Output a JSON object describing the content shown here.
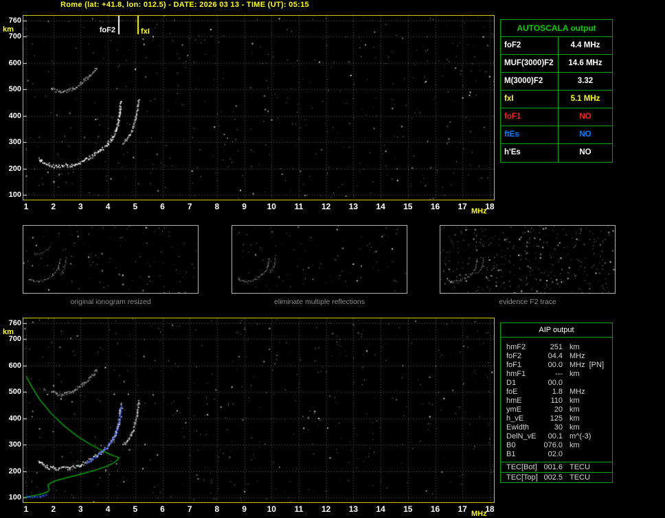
{
  "header": {
    "title": "Rome (lat: +41.8, lon: 012.5) - DATE: 2026 03 13 - TIME (UT): 05:15"
  },
  "colors": {
    "plot_border": "#cfc400",
    "table_border": "#00a400",
    "autoscala_title_green": "#00d000",
    "header_yellow": "#ffff00",
    "axis_label_white": "#ffffff",
    "unit_yellow": "#ffff00",
    "caption_gray": "#8f8f8f",
    "profile_green": "#00c000",
    "restored_blue": "#3355ff",
    "fof1_red": "#ff2020",
    "ftes_blue": "#0080ff"
  },
  "autoscala_table": {
    "title": "AUTOSCALA output",
    "rows": [
      {
        "label": "foF2",
        "value": "4.4 MHz",
        "color": "#ffffff"
      },
      {
        "label": "MUF(3000)F2",
        "value": "14.6 MHz",
        "color": "#ffffff"
      },
      {
        "label": "M(3000)F2",
        "value": "3.32",
        "color": "#ffffff"
      },
      {
        "label": "fxI",
        "value": "5.1 MHz",
        "color": "#ffff00"
      },
      {
        "label": "foF1",
        "value": "NO",
        "color": "#ff2020"
      },
      {
        "label": "ftEs",
        "value": "NO",
        "color": "#0080ff"
      },
      {
        "label": "h'Es",
        "value": "NO",
        "color": "#ffffff"
      }
    ]
  },
  "thumbnails": [
    {
      "caption": "original ionogram resized"
    },
    {
      "caption": "eliminate multiple reflections"
    },
    {
      "caption": "evidence F2 trace"
    }
  ],
  "aip_table": {
    "title": "AIP output",
    "rows": [
      {
        "name": "hmF2",
        "value": "251",
        "unit": "km",
        "extra": ""
      },
      {
        "name": "foF2",
        "value": "04.4",
        "unit": "MHz",
        "extra": ""
      },
      {
        "name": "foF1",
        "value": "00.0",
        "unit": "MHz",
        "extra": "[PN]"
      },
      {
        "name": "hmF1",
        "value": "---",
        "unit": "km",
        "extra": ""
      },
      {
        "name": "D1",
        "value": "00.0",
        "unit": "",
        "extra": ""
      },
      {
        "name": "foE",
        "value": "1.8",
        "unit": "MHz",
        "extra": ""
      },
      {
        "name": "hmE",
        "value": "110",
        "unit": "km",
        "extra": ""
      },
      {
        "name": "ymE",
        "value": "20",
        "unit": "km",
        "extra": ""
      },
      {
        "name": "h_vE",
        "value": "125",
        "unit": "km",
        "extra": ""
      },
      {
        "name": "Ewidth",
        "value": "30",
        "unit": "km",
        "extra": ""
      },
      {
        "name": "DelN_vE",
        "value": "00.1",
        "unit": "m^(-3)",
        "extra": ""
      },
      {
        "name": "B0",
        "value": "076.0",
        "unit": "km",
        "extra": ""
      },
      {
        "name": "B1",
        "value": "02.0",
        "unit": "",
        "extra": ""
      }
    ],
    "tec_rows": [
      {
        "name": "TEC[Bot]",
        "value": "001.6",
        "unit": "TECU"
      },
      {
        "name": "TEC[Top]",
        "value": "002.5",
        "unit": "TECU"
      }
    ]
  },
  "chart_data": [
    {
      "id": "top_ionogram",
      "type": "scatter",
      "title": "ionogram with autoscaled characteristics",
      "xlabel": "MHz",
      "ylabel": "km",
      "xlim": [
        1,
        18
      ],
      "ylim": [
        100,
        760
      ],
      "x_ticks": [
        1,
        2,
        3,
        4,
        5,
        6,
        7,
        8,
        9,
        10,
        11,
        12,
        13,
        14,
        15,
        16,
        17,
        18
      ],
      "y_ticks": [
        760,
        700,
        600,
        500,
        400,
        300,
        200,
        100
      ],
      "grid": true,
      "markers": [
        {
          "label": "foF2",
          "freq": 4.4,
          "color": "#ffffff"
        },
        {
          "label": "fxI",
          "freq": 5.1,
          "color": "#ffff00"
        }
      ],
      "traces": [
        {
          "name": "F2-trace-O-mode",
          "color": "#ffffff",
          "intensity": 1.0,
          "spread": 1.4,
          "points": [
            [
              1.45,
              240
            ],
            [
              1.55,
              228
            ],
            [
              1.7,
              220
            ],
            [
              1.9,
              214
            ],
            [
              2.1,
              211
            ],
            [
              2.35,
              211
            ],
            [
              2.6,
              215
            ],
            [
              2.85,
              222
            ],
            [
              3.1,
              232
            ],
            [
              3.35,
              245
            ],
            [
              3.6,
              262
            ],
            [
              3.85,
              283
            ],
            [
              4.05,
              305
            ],
            [
              4.2,
              328
            ],
            [
              4.3,
              352
            ],
            [
              4.38,
              385
            ],
            [
              4.42,
              420
            ],
            [
              4.45,
              455
            ]
          ]
        },
        {
          "name": "F2-cusp-X-mode",
          "color": "#e8e8e8",
          "intensity": 0.8,
          "spread": 1.1,
          "points": [
            [
              4.55,
              300
            ],
            [
              4.7,
              318
            ],
            [
              4.85,
              342
            ],
            [
              4.95,
              372
            ],
            [
              5.03,
              405
            ],
            [
              5.08,
              440
            ],
            [
              5.12,
              468
            ]
          ]
        },
        {
          "name": "second-hop-multiple",
          "color": "#cccccc",
          "intensity": 0.7,
          "spread": 1.2,
          "points": [
            [
              1.9,
              505
            ],
            [
              2.05,
              496
            ],
            [
              2.25,
              492
            ],
            [
              2.45,
              494
            ],
            [
              2.65,
              502
            ],
            [
              2.85,
              514
            ],
            [
              3.05,
              530
            ],
            [
              3.25,
              548
            ],
            [
              3.45,
              568
            ],
            [
              3.6,
              585
            ]
          ]
        }
      ]
    },
    {
      "id": "bottom_ionogram",
      "type": "scatter",
      "title": "ionogram with restored trace and electron density profile",
      "xlabel": "MHz",
      "ylabel": "km",
      "xlim": [
        1,
        18
      ],
      "ylim": [
        100,
        760
      ],
      "x_ticks": [
        1,
        2,
        3,
        4,
        5,
        6,
        7,
        8,
        9,
        10,
        11,
        12,
        13,
        14,
        15,
        16,
        17,
        18
      ],
      "y_ticks": [
        760,
        700,
        600,
        500,
        400,
        300,
        200,
        100
      ],
      "grid": true,
      "markers": [],
      "traces": [
        {
          "name": "F2-trace-O-mode",
          "color": "#ffffff",
          "intensity": 1.0,
          "spread": 1.4,
          "points": [
            [
              1.45,
              240
            ],
            [
              1.55,
              228
            ],
            [
              1.7,
              220
            ],
            [
              1.9,
              214
            ],
            [
              2.1,
              211
            ],
            [
              2.35,
              211
            ],
            [
              2.6,
              215
            ],
            [
              2.85,
              222
            ],
            [
              3.1,
              232
            ],
            [
              3.35,
              245
            ],
            [
              3.6,
              262
            ],
            [
              3.85,
              283
            ],
            [
              4.05,
              305
            ],
            [
              4.2,
              328
            ],
            [
              4.3,
              352
            ],
            [
              4.38,
              385
            ],
            [
              4.42,
              420
            ],
            [
              4.45,
              455
            ]
          ]
        },
        {
          "name": "F2-cusp-X-mode",
          "color": "#e8e8e8",
          "intensity": 0.8,
          "spread": 1.1,
          "points": [
            [
              4.55,
              300
            ],
            [
              4.7,
              318
            ],
            [
              4.85,
              342
            ],
            [
              4.95,
              372
            ],
            [
              5.03,
              405
            ],
            [
              5.08,
              440
            ],
            [
              5.12,
              468
            ]
          ]
        },
        {
          "name": "second-hop-multiple",
          "color": "#cccccc",
          "intensity": 0.7,
          "spread": 1.2,
          "points": [
            [
              1.9,
              505
            ],
            [
              2.05,
              496
            ],
            [
              2.25,
              492
            ],
            [
              2.45,
              494
            ],
            [
              2.65,
              502
            ],
            [
              2.85,
              514
            ],
            [
              3.05,
              530
            ],
            [
              3.25,
              548
            ],
            [
              3.45,
              568
            ],
            [
              3.6,
              585
            ]
          ]
        }
      ],
      "profile": {
        "name": "electron-density-profile",
        "color": "#00c000",
        "points": [
          [
            1.0,
            560
          ],
          [
            1.2,
            520
          ],
          [
            1.5,
            470
          ],
          [
            1.9,
            420
          ],
          [
            2.4,
            370
          ],
          [
            2.9,
            330
          ],
          [
            3.4,
            298
          ],
          [
            3.8,
            276
          ],
          [
            4.1,
            262
          ],
          [
            4.3,
            254
          ],
          [
            4.4,
            251
          ],
          [
            4.35,
            242
          ],
          [
            4.2,
            230
          ],
          [
            3.9,
            216
          ],
          [
            3.5,
            202
          ],
          [
            3.0,
            188
          ],
          [
            2.5,
            175
          ],
          [
            2.1,
            164
          ],
          [
            1.9,
            155
          ],
          [
            1.8,
            147
          ],
          [
            1.82,
            138
          ],
          [
            1.85,
            130
          ],
          [
            1.8,
            122
          ],
          [
            1.6,
            114
          ],
          [
            1.35,
            108
          ],
          [
            1.1,
            103
          ],
          [
            0.95,
            100
          ]
        ]
      },
      "restored_trace": {
        "name": "autoscala-restored-F2-trace",
        "color": "#3355ff",
        "intensity": 1.0,
        "spread": 0.7,
        "points": [
          [
            3.2,
            232
          ],
          [
            3.5,
            252
          ],
          [
            3.8,
            278
          ],
          [
            4.0,
            300
          ],
          [
            4.15,
            322
          ],
          [
            4.28,
            348
          ],
          [
            4.38,
            382
          ],
          [
            4.44,
            420
          ],
          [
            4.47,
            450
          ]
        ]
      },
      "e_trace": {
        "name": "modeled-E-layer-trace",
        "color": "#3355ff",
        "intensity": 1.0,
        "spread": 0.6,
        "points": [
          [
            1.0,
            105
          ],
          [
            1.2,
            104
          ],
          [
            1.45,
            106
          ],
          [
            1.65,
            110
          ],
          [
            1.75,
            116
          ]
        ]
      }
    }
  ]
}
